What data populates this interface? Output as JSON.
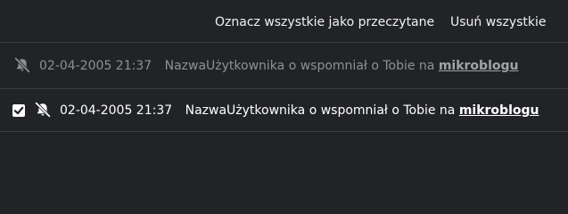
{
  "toolbar": {
    "mark_all_read_label": "Oznacz wszystkie jako przeczytane",
    "delete_all_label": "Usuń wszystkie"
  },
  "notifications": [
    {
      "state": "read",
      "icon": "bell-slash-icon",
      "timestamp": "02-04-2005 21:37",
      "message": "NazwaUżytkownika o wspomniał o Tobie na",
      "link_text": "mikroblogu"
    },
    {
      "state": "selected",
      "checkbox_checked": true,
      "icon": "bell-slash-icon",
      "timestamp": "02-04-2005 21:37",
      "message": "NazwaUżytkownika o wspomniał o Tobie na",
      "link_text": "mikroblogu"
    }
  ],
  "colors": {
    "background": "#212326",
    "divider": "#3a3c40",
    "text_primary": "#ffffff",
    "text_muted": "#8d9096"
  }
}
